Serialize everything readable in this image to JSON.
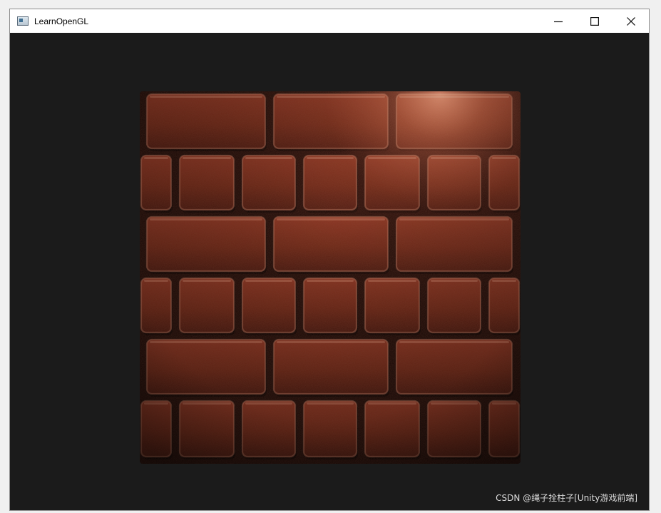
{
  "window": {
    "title": "LearnOpenGL",
    "app_icon": "opengl-window-icon",
    "controls": {
      "minimize_icon": "minimize-icon",
      "maximize_icon": "maximize-icon",
      "close_icon": "close-icon"
    }
  },
  "scene": {
    "background_color": "#1b1b1b",
    "brick_color": "#7a2d1c",
    "highlight_color": "#f08a6c",
    "mortar_color": "#2a1510",
    "brick_rows": [
      {
        "row": 1,
        "bricks": 3,
        "kind": "long"
      },
      {
        "row": 2,
        "bricks": 7,
        "kind": "short"
      },
      {
        "row": 3,
        "bricks": 3,
        "kind": "long"
      },
      {
        "row": 4,
        "bricks": 7,
        "kind": "short"
      },
      {
        "row": 5,
        "bricks": 3,
        "kind": "long"
      },
      {
        "row": 6,
        "bricks": 7,
        "kind": "short"
      }
    ]
  },
  "watermark": {
    "text": "CSDN @绳子拴柱子[Unity游戏前端]"
  }
}
